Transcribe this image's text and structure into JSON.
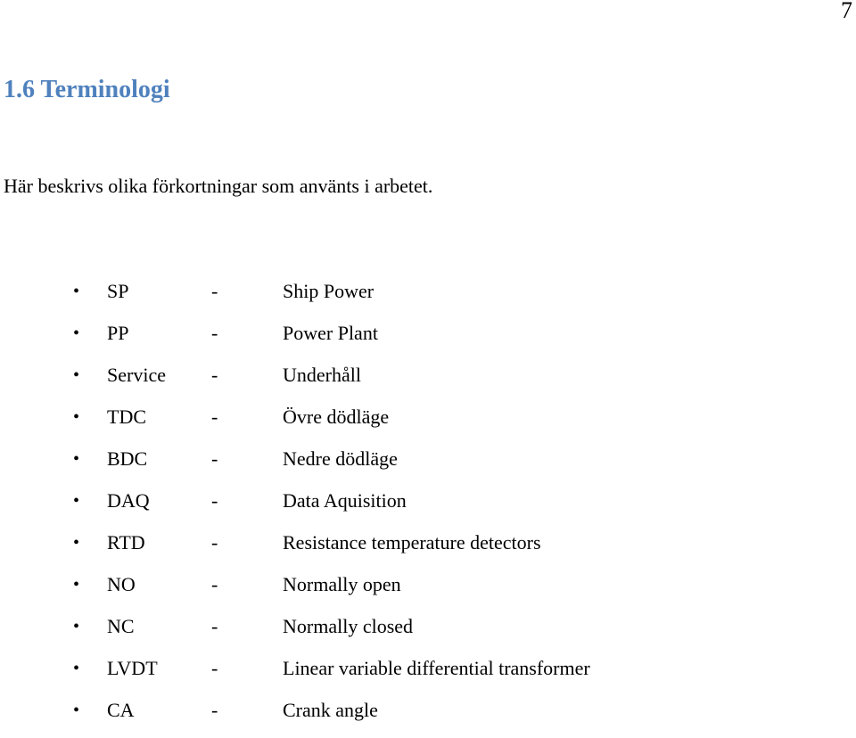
{
  "page": {
    "number": "7",
    "heading": "1.6 Terminologi",
    "intro": "Här beskrivs olika förkortningar som använts i arbetet.",
    "heading_color": "#4f81bd",
    "separator": "-",
    "bullet": "•"
  },
  "terms": [
    {
      "abbr": "SP",
      "meaning": "Ship Power"
    },
    {
      "abbr": "PP",
      "meaning": "Power Plant"
    },
    {
      "abbr": "Service",
      "meaning": "Underhåll"
    },
    {
      "abbr": "TDC",
      "meaning": "Övre dödläge"
    },
    {
      "abbr": "BDC",
      "meaning": "Nedre dödläge"
    },
    {
      "abbr": "DAQ",
      "meaning": "Data Aquisition"
    },
    {
      "abbr": "RTD",
      "meaning": "Resistance temperature detectors"
    },
    {
      "abbr": "NO",
      "meaning": "Normally open"
    },
    {
      "abbr": "NC",
      "meaning": "Normally closed"
    },
    {
      "abbr": "LVDT",
      "meaning": "Linear variable differential transformer"
    },
    {
      "abbr": "CA",
      "meaning": "Crank angle"
    }
  ]
}
